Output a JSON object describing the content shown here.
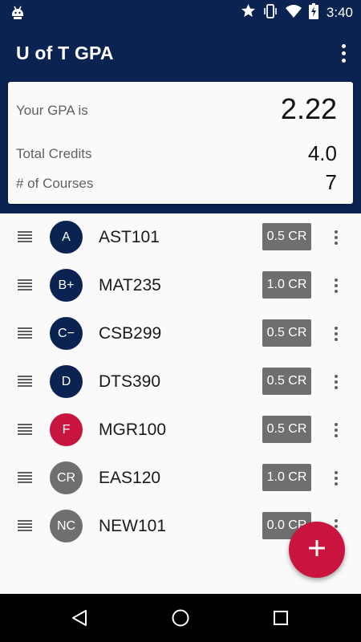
{
  "status_bar": {
    "time": "3:40",
    "icons": [
      "android-debug-icon",
      "star-icon",
      "vibrate-icon",
      "wifi-icon",
      "battery-charging-icon"
    ]
  },
  "app_bar": {
    "title": "U of T GPA",
    "menu_icon": "more-vert-icon"
  },
  "summary": {
    "gpa_label": "Your GPA is",
    "gpa_value": "2.22",
    "credits_label": "Total Credits",
    "credits_value": "4.0",
    "courses_label": "# of Courses",
    "courses_value": "7"
  },
  "courses": [
    {
      "grade": "A",
      "code": "AST101",
      "credits": "0.5 CR",
      "color": "#0b2350"
    },
    {
      "grade": "B+",
      "code": "MAT235",
      "credits": "1.0 CR",
      "color": "#0b2350"
    },
    {
      "grade": "C−",
      "code": "CSB299",
      "credits": "0.5 CR",
      "color": "#0b2350"
    },
    {
      "grade": "D",
      "code": "DTS390",
      "credits": "0.5 CR",
      "color": "#0b2350"
    },
    {
      "grade": "F",
      "code": "MGR100",
      "credits": "0.5 CR",
      "color": "#c8143f"
    },
    {
      "grade": "CR",
      "code": "EAS120",
      "credits": "1.0 CR",
      "color": "#6f6f6f"
    },
    {
      "grade": "NC",
      "code": "NEW101",
      "credits": "0.0 CR",
      "color": "#6f6f6f"
    }
  ],
  "fab": {
    "icon": "add-icon",
    "color": "#c8143f"
  },
  "nav_bar": {
    "icons": [
      "back-icon",
      "home-icon",
      "recents-icon"
    ]
  },
  "colors": {
    "primary": "#0b2350",
    "accent": "#c8143f",
    "neutral": "#6f6f6f"
  }
}
